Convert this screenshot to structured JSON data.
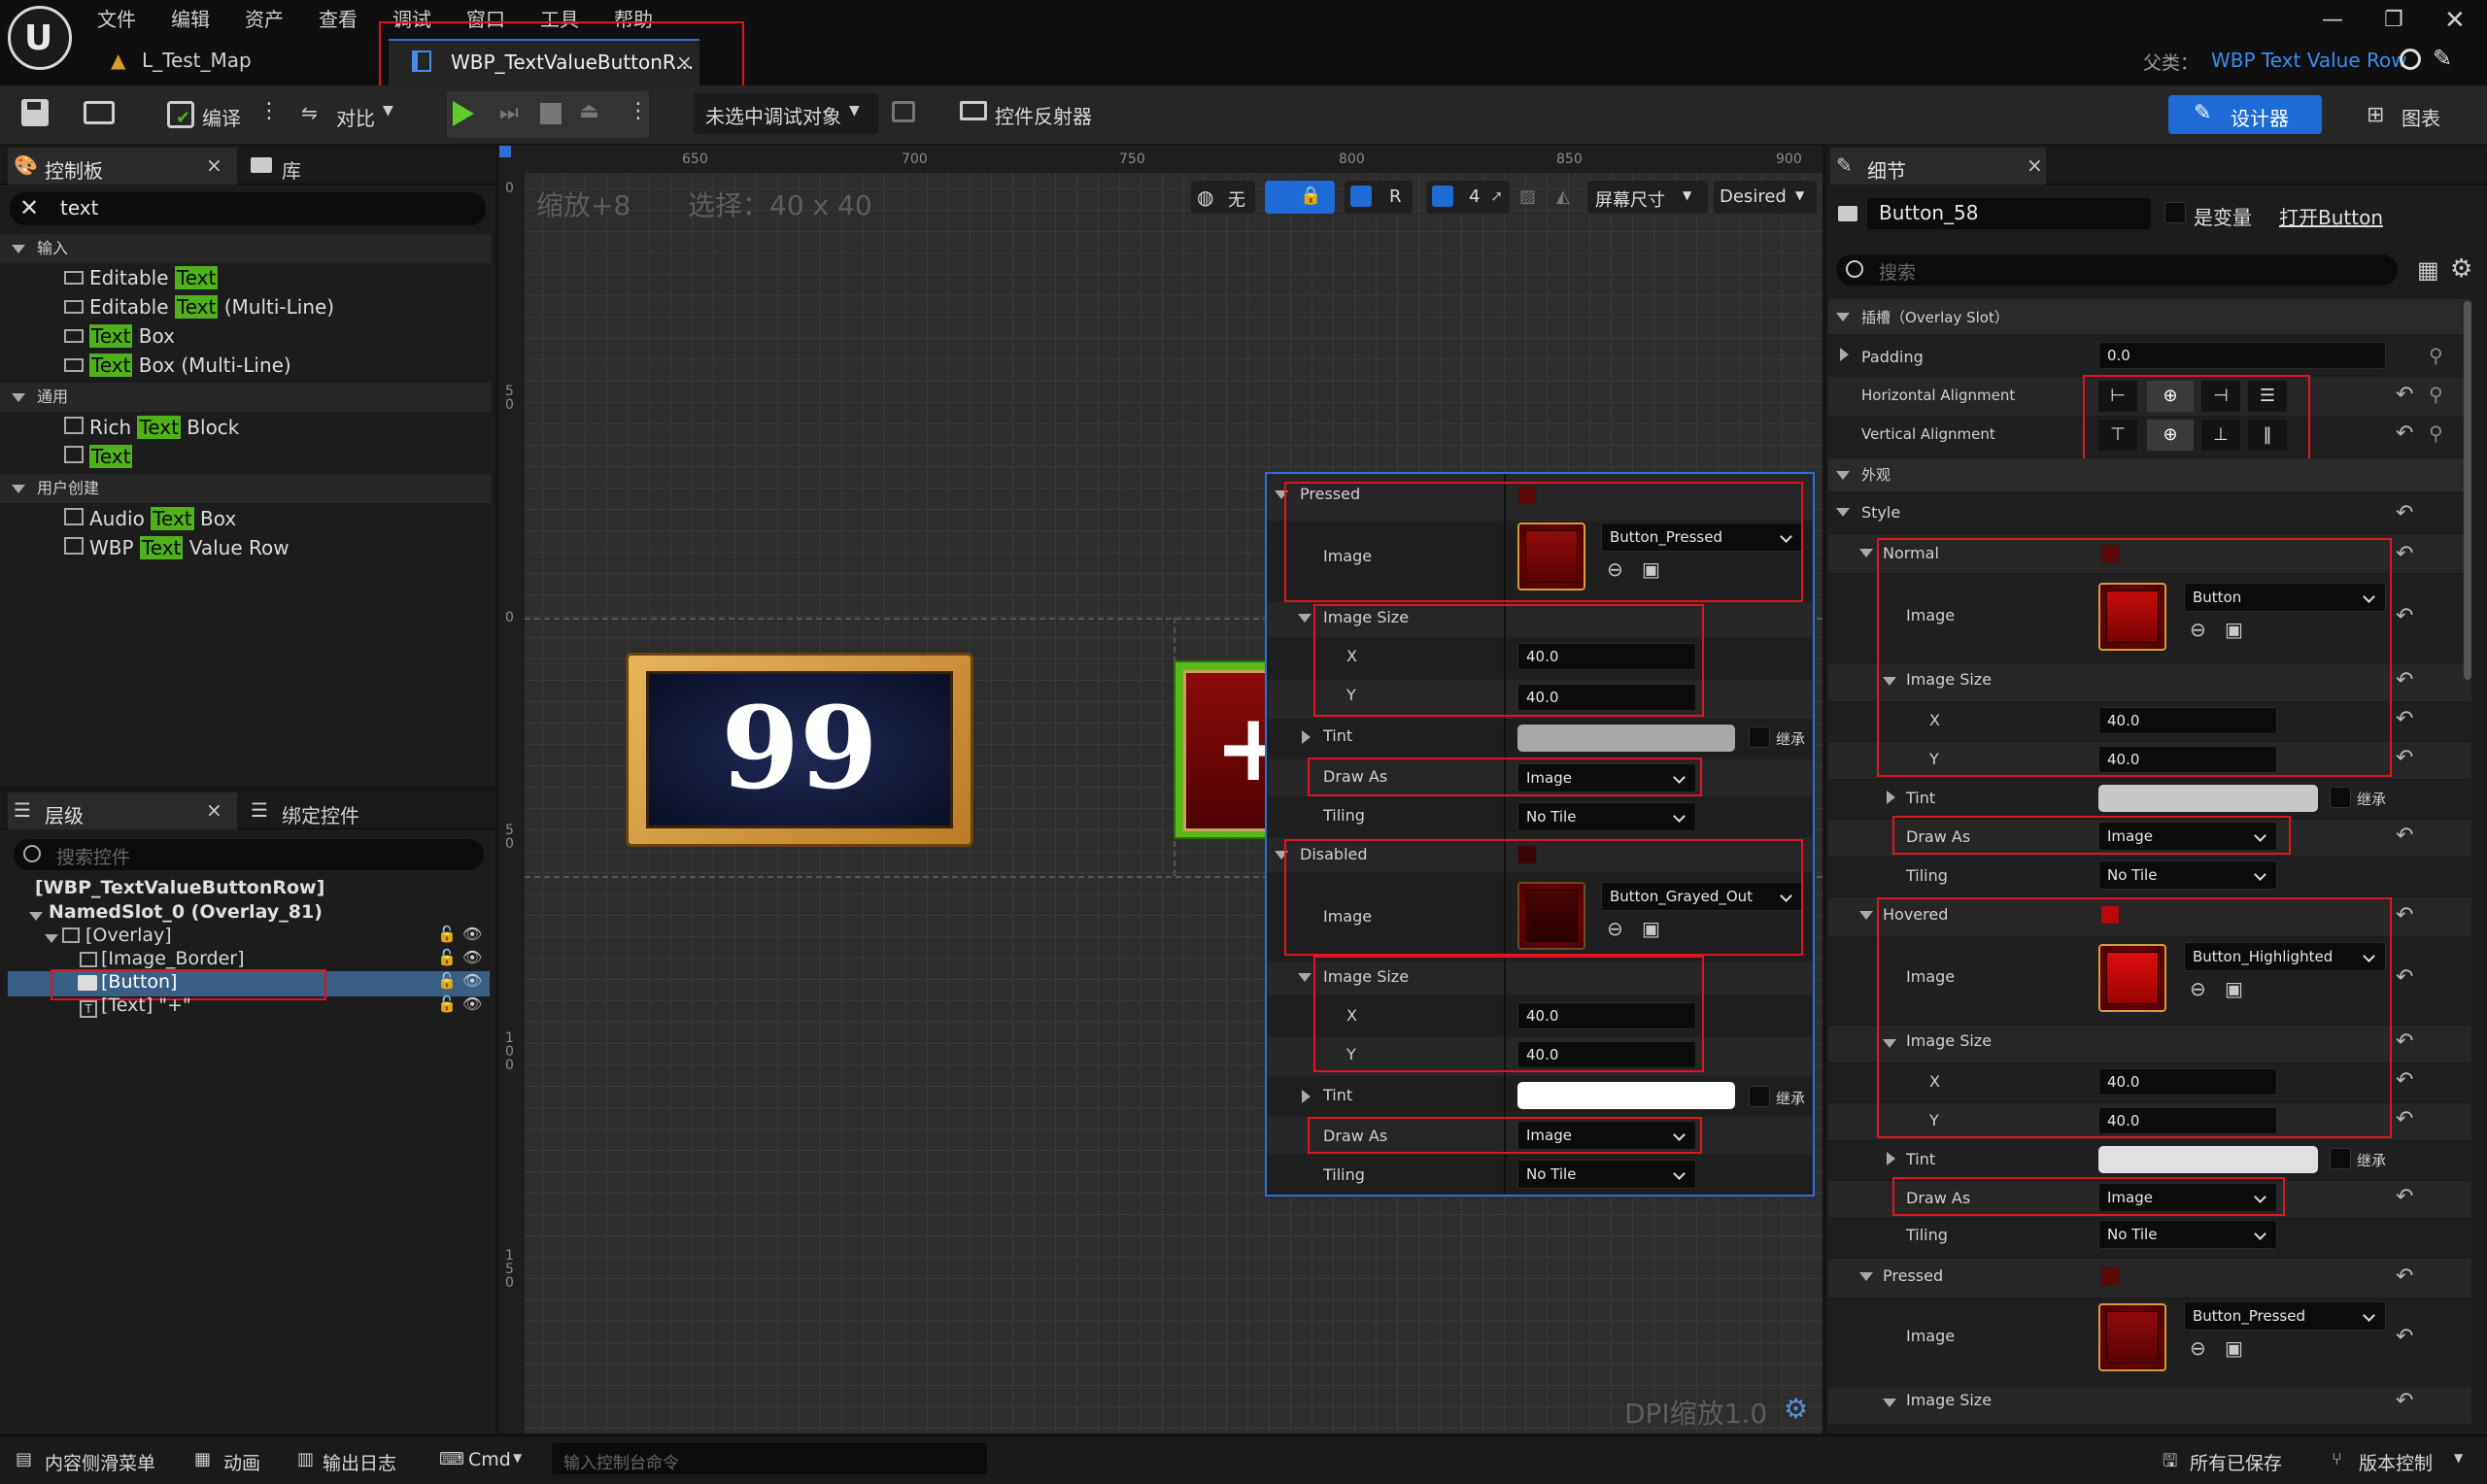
{
  "menu": [
    "文件",
    "编辑",
    "资产",
    "查看",
    "调试",
    "窗口",
    "工具",
    "帮助"
  ],
  "tabs": {
    "level": "L_Test_Map",
    "widget": "WBP_TextValueButtonR...",
    "close": "×"
  },
  "parent": {
    "label": "父类：",
    "value": "WBP Text Value Row"
  },
  "toolbar": {
    "compile": "编译",
    "diff": "对比",
    "debug": "未选中调试对象",
    "reflector": "控件反射器",
    "designer": "设计器",
    "graph": "图表"
  },
  "palette": {
    "tab": "控制板",
    "tab2": "库",
    "search": "text",
    "sections": {
      "input": "输入",
      "common": "通用",
      "user": "用户创建"
    },
    "items": [
      {
        "pre": "Editable ",
        "hl": "Text",
        "post": ""
      },
      {
        "pre": "Editable ",
        "hl": "Text",
        "post": " (Multi-Line)"
      },
      {
        "pre": "",
        "hl": "Text",
        "post": " Box"
      },
      {
        "pre": "",
        "hl": "Text",
        "post": " Box (Multi-Line)"
      },
      {
        "pre": "Rich ",
        "hl": "Text",
        "post": " Block"
      },
      {
        "pre": "",
        "hl": "Text",
        "post": ""
      },
      {
        "pre": "Audio ",
        "hl": "Text",
        "post": " Box"
      },
      {
        "pre": "WBP ",
        "hl": "Text",
        "post": " Value Row"
      }
    ]
  },
  "hierarchy": {
    "tab": "层级",
    "tab2": "绑定控件",
    "search_placeholder": "搜索控件",
    "nodes": [
      "[WBP_TextValueButtonRow]",
      "NamedSlot_0 (Overlay_81)",
      "[Overlay]",
      "[Image_Border]",
      "[Button]",
      "[Text] \"+\""
    ]
  },
  "viewport": {
    "zoom": "缩放+8",
    "selection": "选择：40 x 40",
    "none": "无",
    "r": "R",
    "grid": "4",
    "screen": "屏幕尺寸",
    "desired": "Desired",
    "dpi": "DPI缩放1.0",
    "ruler_top": [
      "650",
      "700",
      "750",
      "800",
      "850",
      "900"
    ],
    "ruler_left": [
      "0",
      "5\n0",
      "0",
      "5\n0",
      "1\n0\n0",
      "1\n5\n0"
    ],
    "value": "99",
    "plus": "+"
  },
  "popup": {
    "pressed": "Pressed",
    "image": "Image",
    "image_size": "Image Size",
    "x": "X",
    "y": "Y",
    "tint": "Tint",
    "inherit": "继承",
    "draw_as": "Draw As",
    "tiling": "Tiling",
    "disabled": "Disabled",
    "pressed_img": "Button_Pressed",
    "disabled_img": "Button_Grayed_Out",
    "x_val": "40.0",
    "y_val": "40.0",
    "draw_val": "Image",
    "tile_val": "No Tile"
  },
  "details": {
    "tab": "细节",
    "name": "Button_58",
    "is_var": "是变量",
    "open": "打开Button",
    "search": "搜索",
    "slot": "插槽（Overlay Slot）",
    "padding": "Padding",
    "padding_val": "0.0",
    "halign": "Horizontal Alignment",
    "valign": "Vertical Alignment",
    "appearance": "外观",
    "style": "Style",
    "normal": "Normal",
    "image": "Image",
    "image_size": "Image Size",
    "x": "X",
    "y": "Y",
    "tint": "Tint",
    "inherit": "继承",
    "draw_as": "Draw As",
    "tiling": "Tiling",
    "hovered": "Hovered",
    "pressed": "Pressed",
    "normal_img": "Button",
    "hovered_img": "Button_Highlighted",
    "pressed_img": "Button_Pressed",
    "val40": "40.0",
    "draw_val": "Image",
    "tile_val": "No Tile"
  },
  "status": {
    "drawer": "内容侧滑菜单",
    "anim": "动画",
    "log": "输出日志",
    "cmd": "Cmd",
    "console": "输入控制台命令",
    "saved": "所有已保存",
    "vc": "版本控制"
  }
}
